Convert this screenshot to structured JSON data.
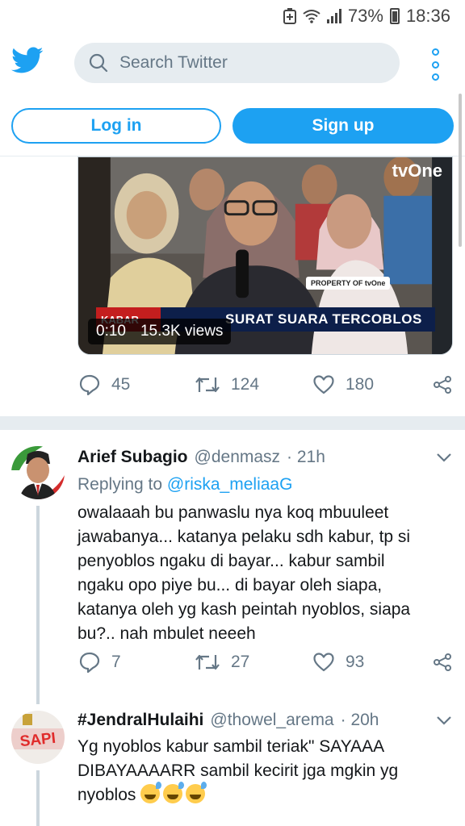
{
  "status_bar": {
    "battery": "73%",
    "time": "18:36"
  },
  "header": {
    "search_placeholder": "Search Twitter",
    "login_label": "Log in",
    "signup_label": "Sign up"
  },
  "video_tweet": {
    "video": {
      "channel_logo": "tvOne",
      "property_tag": "PROPERTY OF tvOne",
      "kabar_tag": "KABAR",
      "headline": "SURAT SUARA TERCOBLOS",
      "duration": "0:10",
      "views": "15.3K views"
    },
    "replies": "45",
    "retweets": "124",
    "likes": "180"
  },
  "replies": [
    {
      "name": "Arief Subagio",
      "handle": "@denmasz",
      "time": "· 21h",
      "replying_prefix": "Replying to",
      "replying_to": "@riska_meliaaG",
      "text": "owalaaah bu panwaslu nya koq mbuuleet jawabanya... katanya pelaku sdh kabur, tp si penyoblos ngaku di bayar... kabur sambil ngaku opo piye bu... di bayar oleh siapa, katanya oleh yg kash peintah nyoblos, siapa bu?.. nah mbulet neeeh",
      "replies": "7",
      "retweets": "27",
      "likes": "93"
    },
    {
      "name": "#JendralHulaihi",
      "handle": "@thowel_arema",
      "time": "· 20h",
      "text": "Yg nyoblos kabur sambil teriak\" SAYAAA DIBAYAAAARR sambil kecirit jga mgkin yg nyoblos",
      "avatar_text": "SAPI"
    }
  ],
  "colors": {
    "twitter_blue": "#1da1f2",
    "muted": "#657786",
    "border": "#e6ecf0"
  }
}
